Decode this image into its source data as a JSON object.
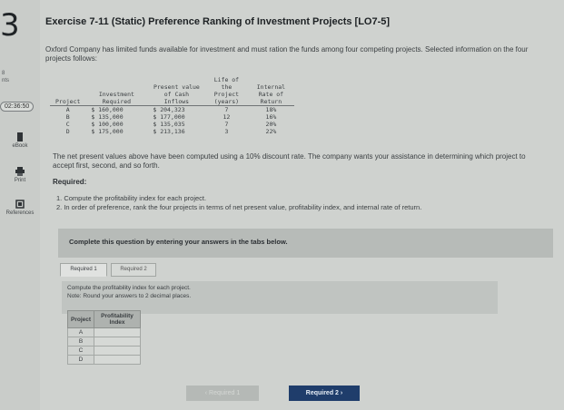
{
  "page": {
    "question_number": "3",
    "title": "Exercise 7-11 (Static) Preference Ranking of Investment Projects [LO7-5]",
    "intro": "Oxford Company has limited funds available for investment and must ration the funds among four competing projects. Selected information on the four projects follows:",
    "note": "The net present values above have been computed using a 10% discount rate. The company wants your assistance in determining which project to accept first, second, and so forth.",
    "required_heading": "Required:",
    "requirements": [
      "1. Compute the profitability index for each project.",
      "2. In order of preference, rank the four projects in terms of net present value, profitability index, and internal rate of return."
    ],
    "banner": "Complete this question by entering your answers in the tabs below."
  },
  "sidebar": {
    "points_label": "8",
    "points_sub": "nts",
    "timer": "02:36:50",
    "ebook_label": "eBook",
    "print_label": "Print",
    "references_label": "References"
  },
  "project_table": {
    "headers": [
      "Project",
      "Investment Required",
      "Present value of Cash Inflows",
      "Life of the Project (years)",
      "Internal Rate of Return"
    ],
    "rows": [
      {
        "project": "A",
        "investment": "$ 160,000",
        "pv": "$ 204,323",
        "life": "7",
        "irr": "18%"
      },
      {
        "project": "B",
        "investment": "$ 135,000",
        "pv": "$ 177,000",
        "life": "12",
        "irr": "16%"
      },
      {
        "project": "C",
        "investment": "$ 100,000",
        "pv": "$ 135,035",
        "life": "7",
        "irr": "20%"
      },
      {
        "project": "D",
        "investment": "$ 175,000",
        "pv": "$ 213,136",
        "life": "3",
        "irr": "22%"
      }
    ]
  },
  "tabs": [
    "Required 1",
    "Required 2"
  ],
  "active_tab": "Required 1",
  "prompt": {
    "line1": "Compute the profitability index for each project.",
    "line2": "Note: Round your answers to 2 decimal places."
  },
  "pi_table": {
    "headers": [
      "Project",
      "Profitability Index"
    ],
    "projects": [
      "A",
      "B",
      "C",
      "D"
    ],
    "values": [
      "",
      "",
      "",
      ""
    ]
  },
  "nav": {
    "prev_label": "‹  Required 1",
    "next_label": "Required 2  ›"
  }
}
